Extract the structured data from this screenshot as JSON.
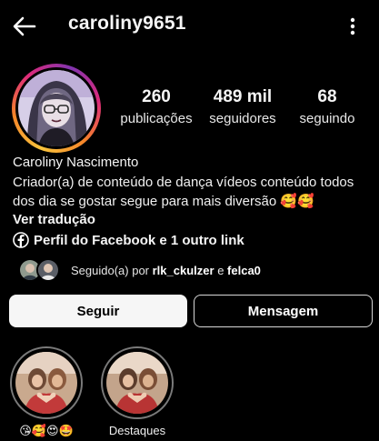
{
  "header": {
    "username": "caroliny9651",
    "back_icon": "arrow-left-icon",
    "more_icon": "more-vertical-icon"
  },
  "profile": {
    "stats": [
      {
        "value": "260",
        "label": "publicações"
      },
      {
        "value": "489 mil",
        "label": "seguidores"
      },
      {
        "value": "68",
        "label": "seguindo"
      }
    ],
    "name": "Caroliny Nascimento",
    "bio": "Criador(a) de conteúdo de dança vídeos conteúdo todos dos dia se gostar segue para mais diversão 🥰🥰",
    "translate_label": "Ver tradução",
    "link_text": "Perfil do Facebook e 1 outro link",
    "followed_by": {
      "prefix": "Seguido(a) por",
      "user1": "rlk_ckulzer",
      "conj": "e",
      "user2": "felca0"
    }
  },
  "actions": {
    "follow_label": "Seguir",
    "message_label": "Mensagem"
  },
  "highlights": [
    {
      "caption": "😘🥰😍🤩"
    },
    {
      "caption": "Destaques"
    }
  ],
  "colors": {
    "background": "#000000",
    "follow_button": "#f6f6f6",
    "story_ring_start": "#f9c33c",
    "story_ring_end": "#8134af"
  }
}
